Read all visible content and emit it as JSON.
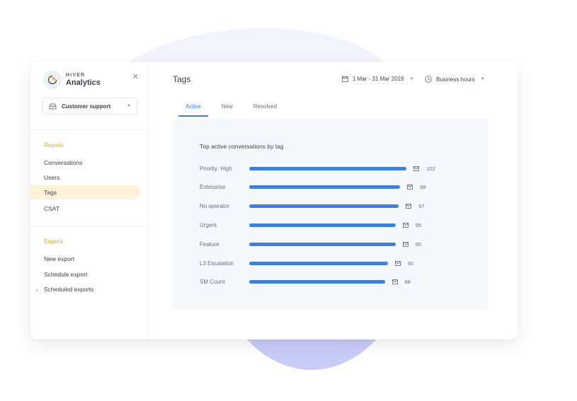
{
  "brand": {
    "sub": "HIVER",
    "title": "Analytics",
    "icon": "pie-chart-icon"
  },
  "sidebar": {
    "inbox_select": {
      "label": "Customer support",
      "icon": "inbox-icon"
    },
    "reports_title": "Reports",
    "reports": [
      {
        "label": "Conversations",
        "active": false
      },
      {
        "label": "Users",
        "active": false
      },
      {
        "label": "Tags",
        "active": true
      },
      {
        "label": "CSAT",
        "active": false
      }
    ],
    "exports_title": "Exports",
    "exports": [
      {
        "label": "New export"
      },
      {
        "label": "Schedule export"
      },
      {
        "label": "Scheduled exports",
        "expandable": true
      }
    ]
  },
  "header": {
    "title": "Tags",
    "date_range": "1 Mar - 31 Mar 2019",
    "hours": "Business hours"
  },
  "tabs": [
    {
      "label": "Active",
      "active": true
    },
    {
      "label": "New",
      "active": false
    },
    {
      "label": "Resolved",
      "active": false
    }
  ],
  "colors": {
    "accent": "#3d7fe0",
    "section": "#e2a22a",
    "active_bg": "#fff1d6"
  },
  "chart_data": {
    "type": "bar",
    "orientation": "horizontal",
    "title": "Top active conversations by tag",
    "categories": [
      "Priority: High",
      "Enterprise",
      "No operator",
      "Urgent",
      "Feature",
      "L3 Escalation",
      "SM Count"
    ],
    "values": [
      102,
      98,
      97,
      95,
      95,
      90,
      88
    ],
    "value_icon": "mail-icon",
    "xlabel": "",
    "ylabel": ""
  }
}
